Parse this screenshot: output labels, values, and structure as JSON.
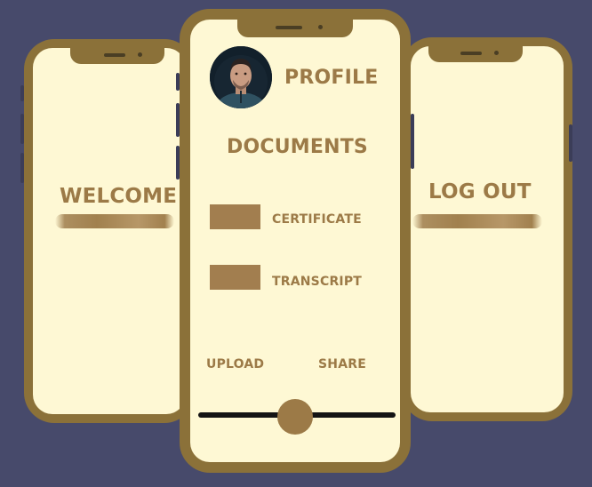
{
  "left_screen": {
    "title": "WELCOME"
  },
  "center_screen": {
    "profile_label": "PROFILE",
    "documents_title": "DOCUMENTS",
    "documents": [
      {
        "label": "CERTIFICATE"
      },
      {
        "label": "TRANSCRIPT"
      }
    ],
    "upload_label": "UPLOAD",
    "share_label": "SHARE",
    "avatar_icon": "profile-photo",
    "slider_value": 0.5
  },
  "right_screen": {
    "title": "LOG OUT"
  },
  "colors": {
    "background": "#474a6b",
    "phone_frame": "#8b7139",
    "screen": "#fef8d4",
    "accent_text": "#9c7a47"
  }
}
